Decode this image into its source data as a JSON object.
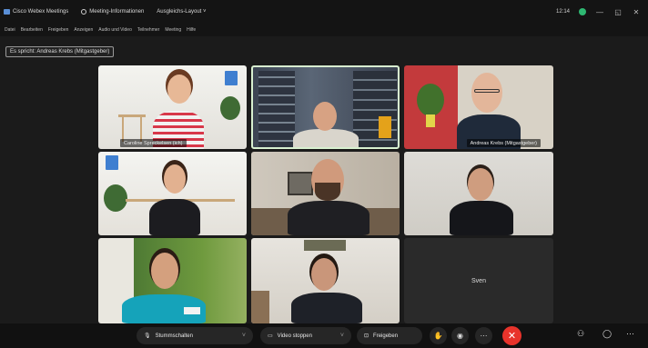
{
  "titlebar": {
    "app_title": "Cisco Webex Meetings",
    "meeting_info": "Meeting-Informationen",
    "layout_label": "Ausgleichs-Layout",
    "time": "12:14",
    "window_controls": [
      "—",
      "◱",
      "✕"
    ]
  },
  "menu": {
    "items": [
      "Datei",
      "Bearbeiten",
      "Freigeben",
      "Anzeigen",
      "Audio und Video",
      "Teilnehmer",
      "Meeting",
      "Hilfe"
    ]
  },
  "speaker_banner": "Es spricht: Andreas Krebs (Mitgastgeber)",
  "participants": [
    {
      "name": "Caroline Spreckelsen (ich)"
    },
    {
      "name": ""
    },
    {
      "name": "Andreas Krebs (Mitgastgeber)"
    },
    {
      "name": ""
    },
    {
      "name": ""
    },
    {
      "name": ""
    },
    {
      "name": ""
    },
    {
      "name": ""
    },
    {
      "name": "Sven"
    }
  ],
  "toolbar": {
    "mute_label": "Stummschalten",
    "video_label": "Video stoppen",
    "share_label": "Freigeben",
    "end_icon": "✕"
  },
  "colors": {
    "end_call": "#e8332b",
    "status": "#2eb872",
    "active_border": "#d8f0d0"
  }
}
